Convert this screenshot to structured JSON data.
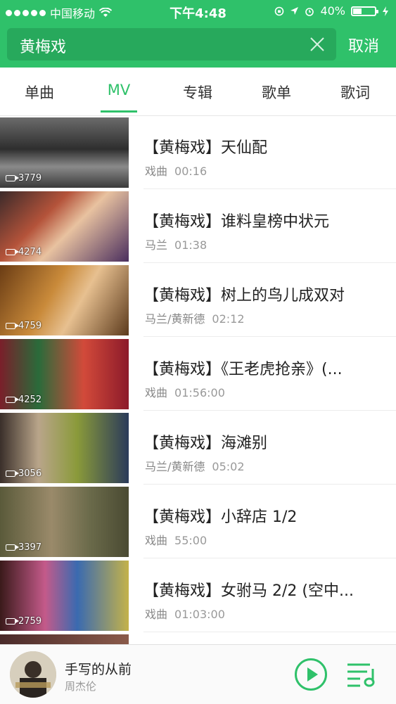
{
  "status_bar": {
    "carrier": "中国移动",
    "time": "下午4:48",
    "battery": "40%",
    "battery_level": 0.4
  },
  "search": {
    "query": "黄梅戏",
    "cancel_label": "取消"
  },
  "tabs": [
    {
      "label": "单曲",
      "active": false
    },
    {
      "label": "MV",
      "active": true
    },
    {
      "label": "专辑",
      "active": false
    },
    {
      "label": "歌单",
      "active": false
    },
    {
      "label": "歌词",
      "active": false
    }
  ],
  "results": [
    {
      "title": "【黄梅戏】天仙配",
      "artist": "戏曲",
      "duration": "00:16",
      "views": "3779"
    },
    {
      "title": "【黄梅戏】谁料皇榜中状元",
      "artist": "马兰",
      "duration": "01:38",
      "views": "4274"
    },
    {
      "title": "【黄梅戏】树上的鸟儿成双对",
      "artist": "马兰/黄新德",
      "duration": "02:12",
      "views": "4759"
    },
    {
      "title": "【黄梅戏】《王老虎抢亲》(...",
      "artist": "戏曲",
      "duration": "01:56:00",
      "views": "4252"
    },
    {
      "title": "【黄梅戏】海滩别",
      "artist": "马兰/黄新德",
      "duration": "05:02",
      "views": "3056"
    },
    {
      "title": "【黄梅戏】小辞店 1/2",
      "artist": "戏曲",
      "duration": "55:00",
      "views": "3397"
    },
    {
      "title": "【黄梅戏】女驸马 2/2 (空中...",
      "artist": "戏曲",
      "duration": "01:03:00",
      "views": "2759"
    }
  ],
  "player": {
    "song": "手写的从前",
    "artist": "周杰伦"
  },
  "colors": {
    "brand": "#2fc16a",
    "search_bg": "#27a95c"
  }
}
